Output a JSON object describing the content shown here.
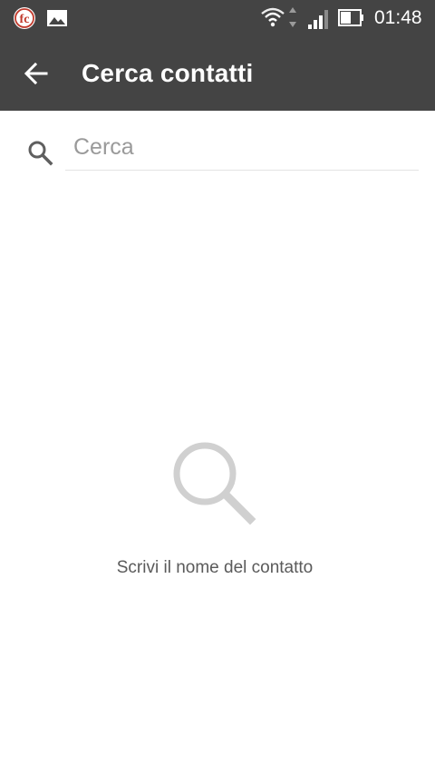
{
  "status_bar": {
    "time": "01:48",
    "icons": [
      "fc-app-icon",
      "gallery-icon",
      "wifi-icon",
      "data-arrows-icon",
      "signal-icon",
      "battery-icon"
    ],
    "colors": {
      "background": "#444444",
      "foreground": "#ffffff"
    }
  },
  "app_bar": {
    "title": "Cerca contatti",
    "back_icon": "arrow-back-icon",
    "colors": {
      "background": "#444444",
      "title": "#ffffff"
    }
  },
  "search": {
    "placeholder": "Cerca",
    "value": "",
    "icon": "search-icon"
  },
  "empty_state": {
    "icon": "large-search-icon",
    "message": "Scrivi il nome del contatto",
    "colors": {
      "icon": "#d0d0d0",
      "message": "#5a5a5a"
    }
  }
}
